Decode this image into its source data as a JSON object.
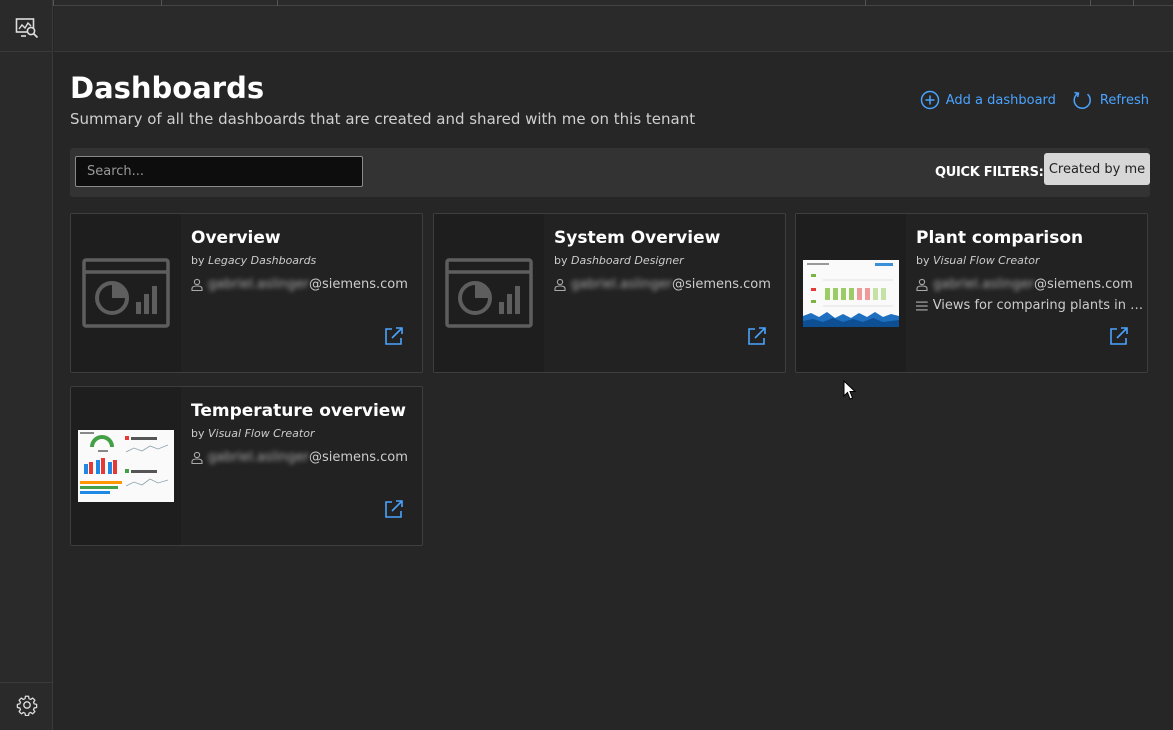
{
  "page": {
    "title": "Dashboards",
    "subtitle": "Summary of all the dashboards that are created and shared with me on this tenant"
  },
  "actions": {
    "add_label": "Add a dashboard",
    "refresh_label": "Refresh"
  },
  "filters": {
    "search_placeholder": "Search...",
    "quick_filters_label": "QUICK FILTERS:",
    "created_by_me_label": "Created by me"
  },
  "cards": [
    {
      "name": "Overview",
      "by_prefix": "by",
      "creator": "Legacy Dashboards",
      "owner_blurred": "gabriel.aslinger",
      "owner_domain": "@siemens.com",
      "thumbnail": "dashboard-placeholder-icon"
    },
    {
      "name": "System Overview",
      "by_prefix": "by",
      "creator": "Dashboard Designer",
      "owner_blurred": "gabriel.aslinger",
      "owner_domain": "@siemens.com",
      "thumbnail": "dashboard-placeholder-icon"
    },
    {
      "name": "Plant comparison",
      "by_prefix": "by",
      "creator": "Visual Flow Creator",
      "owner_blurred": "gabriel.aslinger",
      "owner_domain": "@siemens.com",
      "description": "Views for comparing plants in s...",
      "thumbnail": "plant-comparison-preview"
    },
    {
      "name": "Temperature overview",
      "by_prefix": "by",
      "creator": "Visual Flow Creator",
      "owner_blurred": "gabriel.aslinger",
      "owner_domain": "@siemens.com",
      "thumbnail": "temperature-overview-preview"
    }
  ],
  "colors": {
    "accent": "#4aa3ff",
    "background": "#262626",
    "card": "#222222"
  }
}
